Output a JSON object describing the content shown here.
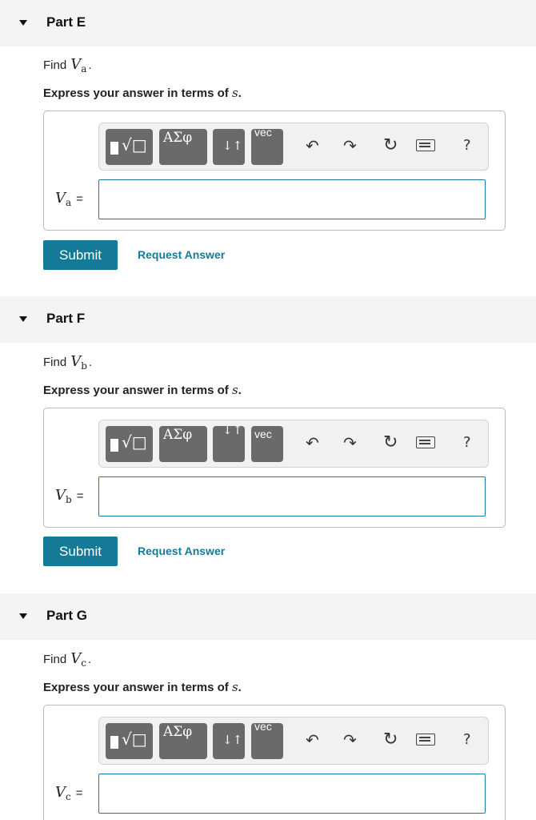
{
  "parts": [
    {
      "title": "Part E",
      "find_prefix": "Find",
      "var_symbol": "V",
      "var_sub": "a",
      "find_suffix": ".",
      "express_prefix": "Express your answer in terms of",
      "express_var": "s",
      "express_suffix": ".",
      "label_var": "V",
      "label_sub": "a",
      "label_eq": "=",
      "input_value": "",
      "submit_label": "Submit",
      "request_label": "Request Answer"
    },
    {
      "title": "Part F",
      "find_prefix": "Find",
      "var_symbol": "V",
      "var_sub": "b",
      "find_suffix": ".",
      "express_prefix": "Express your answer in terms of",
      "express_var": "s",
      "express_suffix": ".",
      "label_var": "V",
      "label_sub": "b",
      "label_eq": "=",
      "input_value": "",
      "submit_label": "Submit",
      "request_label": "Request Answer"
    },
    {
      "title": "Part G",
      "find_prefix": "Find",
      "var_symbol": "V",
      "var_sub": "c",
      "find_suffix": ".",
      "express_prefix": "Express your answer in terms of",
      "express_var": "s",
      "express_suffix": ".",
      "label_var": "V",
      "label_sub": "c",
      "label_eq": "=",
      "input_value": ""
    }
  ],
  "toolbar": {
    "templates_glyph": "√□",
    "greek_glyph": "ΑΣφ",
    "arrows_glyph": "↓↑",
    "vec_glyph": "vec",
    "undo_glyph": "↶",
    "redo_glyph": "↷",
    "reset_glyph": "↻",
    "help_glyph": "?"
  },
  "colors": {
    "accent": "#157a98",
    "input_border": "#1a7aa4",
    "header_bg": "#f4f4f4",
    "toolbar_button": "#6a6a6a"
  },
  "icons": [
    "caret-down-icon",
    "templates-icon",
    "greek-letters-icon",
    "arrows-icon",
    "vector-icon",
    "undo-icon",
    "redo-icon",
    "reset-icon",
    "keyboard-icon",
    "help-icon"
  ]
}
